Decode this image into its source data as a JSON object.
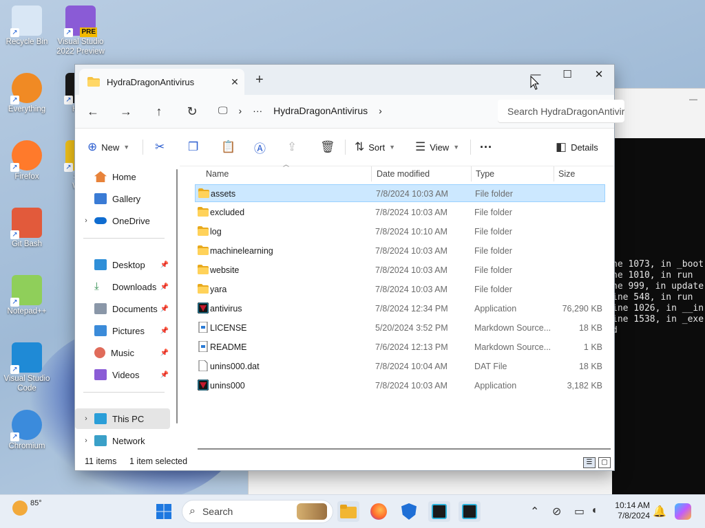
{
  "desktop": {
    "icons": [
      {
        "label": "Recycle Bin",
        "icon": "recycle-bin-icon"
      },
      {
        "label": "Visual Studio 2022 Preview",
        "icon": "visual-studio-preview-icon",
        "badge": "PRE"
      },
      {
        "label": "Everything",
        "icon": "everything-search-icon"
      },
      {
        "label": "Hydr",
        "icon": "hydra-dragon-icon"
      },
      {
        "label": "Firefox",
        "icon": "firefox-icon"
      },
      {
        "label": "San\nWeb",
        "icon": "sandboxie-icon"
      },
      {
        "label": "Git Bash",
        "icon": "git-bash-icon"
      },
      {
        "label": "Notepad++",
        "icon": "notepad-plus-plus-icon"
      },
      {
        "label": "Visual Studio Code",
        "icon": "vscode-icon"
      },
      {
        "label": "Chromium",
        "icon": "chromium-icon"
      }
    ]
  },
  "console": {
    "lines": [
      "ne 1073, in _boot",
      "ne 1010, in run",
      "ne 999, in update",
      "ine 548, in run",
      "ine 1026, in __in",
      "ine 1538, in _exe",
      "d"
    ]
  },
  "explorer": {
    "tab_title": "HydraDragonAntivirus",
    "new_tab": "+",
    "tab_close": "✕",
    "window_controls": {
      "minimize": "—",
      "maximize": "☐",
      "close": "✕"
    },
    "nav": {
      "back": "←",
      "forward": "→",
      "up": "↑",
      "refresh": "↻"
    },
    "breadcrumb": {
      "computer": "🖵",
      "more": "···",
      "folder": "HydraDragonAntivirus",
      "chevron": "›"
    },
    "search_placeholder": "Search HydraDragonAntivirus",
    "toolbar": {
      "new": "New",
      "sort": "Sort",
      "view": "View",
      "more": "···",
      "details": "Details"
    },
    "sidebar": {
      "home": "Home",
      "gallery": "Gallery",
      "onedrive": "OneDrive",
      "desktop": "Desktop",
      "downloads": "Downloads",
      "documents": "Documents",
      "pictures": "Pictures",
      "music": "Music",
      "videos": "Videos",
      "this_pc": "This PC",
      "network": "Network"
    },
    "columns": {
      "name": "Name",
      "date": "Date modified",
      "type": "Type",
      "size": "Size"
    },
    "files": [
      {
        "name": "assets",
        "date": "7/8/2024 10:03 AM",
        "type": "File folder",
        "size": "",
        "kind": "folder",
        "selected": true
      },
      {
        "name": "excluded",
        "date": "7/8/2024 10:03 AM",
        "type": "File folder",
        "size": "",
        "kind": "folder"
      },
      {
        "name": "log",
        "date": "7/8/2024 10:10 AM",
        "type": "File folder",
        "size": "",
        "kind": "folder"
      },
      {
        "name": "machinelearning",
        "date": "7/8/2024 10:03 AM",
        "type": "File folder",
        "size": "",
        "kind": "folder"
      },
      {
        "name": "website",
        "date": "7/8/2024 10:03 AM",
        "type": "File folder",
        "size": "",
        "kind": "folder"
      },
      {
        "name": "yara",
        "date": "7/8/2024 10:03 AM",
        "type": "File folder",
        "size": "",
        "kind": "folder"
      },
      {
        "name": "antivirus",
        "date": "7/8/2024 12:34 PM",
        "type": "Application",
        "size": "76,290 KB",
        "kind": "app"
      },
      {
        "name": "LICENSE",
        "date": "5/20/2024 3:52 PM",
        "type": "Markdown Source...",
        "size": "18 KB",
        "kind": "md"
      },
      {
        "name": "README",
        "date": "7/6/2024 12:13 PM",
        "type": "Markdown Source...",
        "size": "1 KB",
        "kind": "md"
      },
      {
        "name": "unins000.dat",
        "date": "7/8/2024 10:04 AM",
        "type": "DAT File",
        "size": "18 KB",
        "kind": "file"
      },
      {
        "name": "unins000",
        "date": "7/8/2024 10:03 AM",
        "type": "Application",
        "size": "3,182 KB",
        "kind": "app"
      }
    ],
    "status": {
      "items": "11 items",
      "selected": "1 item selected"
    }
  },
  "taskbar": {
    "weather": "85°",
    "search_label": "Search",
    "time": "10:14 AM",
    "date": "7/8/2024"
  }
}
